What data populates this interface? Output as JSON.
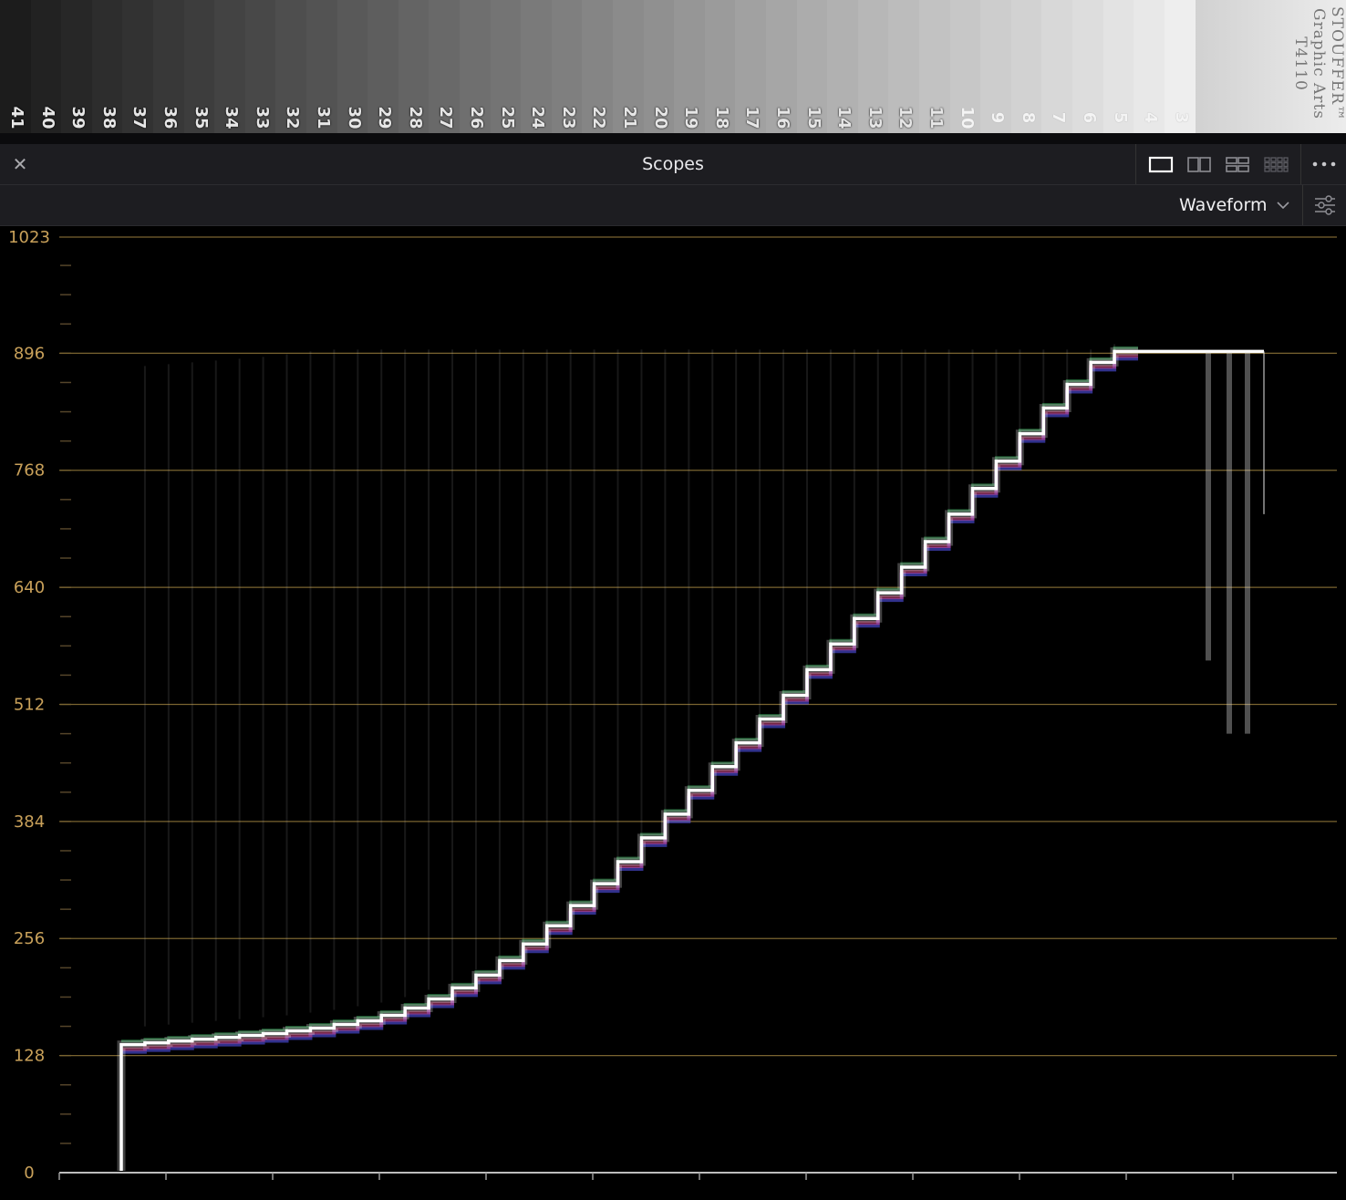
{
  "chart_data": {
    "type": "line",
    "scope": "waveform",
    "y_ticks": [
      "1023",
      "896",
      "768",
      "640",
      "512",
      "384",
      "256",
      "128",
      "0"
    ],
    "ylim": [
      0,
      1023
    ],
    "grid": true,
    "gridline_color": "#7a6430",
    "label_color": "#c9a15a",
    "trace_color": "#ffffff",
    "series": [
      {
        "x": [
          0.05,
          0.11,
          0.15,
          0.2,
          0.24,
          0.28,
          0.32,
          0.36,
          0.4,
          0.44,
          0.48,
          0.52,
          0.57,
          0.61,
          0.65,
          0.69,
          0.73,
          0.77,
          0.81,
          0.85,
          0.89,
          0.93,
          0.97,
          0.94,
          0.98,
          0.99
        ],
        "values": [
          140,
          143,
          148,
          153,
          157,
          163,
          170,
          182,
          195,
          213,
          232,
          253,
          275,
          297,
          320,
          344,
          370,
          396,
          422,
          448,
          474,
          502,
          530,
          556,
          584,
          612
        ]
      },
      {
        "x": [
          0.02,
          0.05,
          0.08,
          0.11,
          0.15,
          0.2,
          0.24,
          0.28,
          0.32,
          0.37,
          0.42
        ],
        "values": [
          640,
          668,
          694,
          721,
          750,
          778,
          806,
          835,
          862,
          886,
          898
        ]
      }
    ],
    "notes_steps": 41
  },
  "step_wedge": {
    "numbers": [
      "41",
      "40",
      "39",
      "38",
      "37",
      "36",
      "35",
      "34",
      "33",
      "32",
      "31",
      "30",
      "29",
      "28",
      "27",
      "26",
      "25",
      "24",
      "23",
      "22",
      "21",
      "20",
      "19",
      "18",
      "17",
      "16",
      "15",
      "14",
      "13",
      "12",
      "11",
      "10",
      "9",
      "8",
      "7",
      "6",
      "5",
      "4",
      "3"
    ],
    "brand_lines": [
      "STOUFFER™",
      "Graphic Arts",
      "T4110"
    ]
  },
  "panel": {
    "title": "Scopes",
    "close_icon": "close-icon",
    "layouts": [
      "single-layout-icon",
      "dual-layout-icon",
      "quad-layout-icon",
      "grid-layout-icon"
    ],
    "more_icon": "more-options-icon",
    "active_layout": "single"
  },
  "toolbar": {
    "scope_type": "Waveform",
    "dropdown_icon": "chevron-down-icon",
    "settings_icon": "settings-sliders-icon"
  },
  "colors": {
    "panel_bg": "#1d1d21",
    "text": "#e9e9ec",
    "accent_label": "#c9a15a"
  }
}
